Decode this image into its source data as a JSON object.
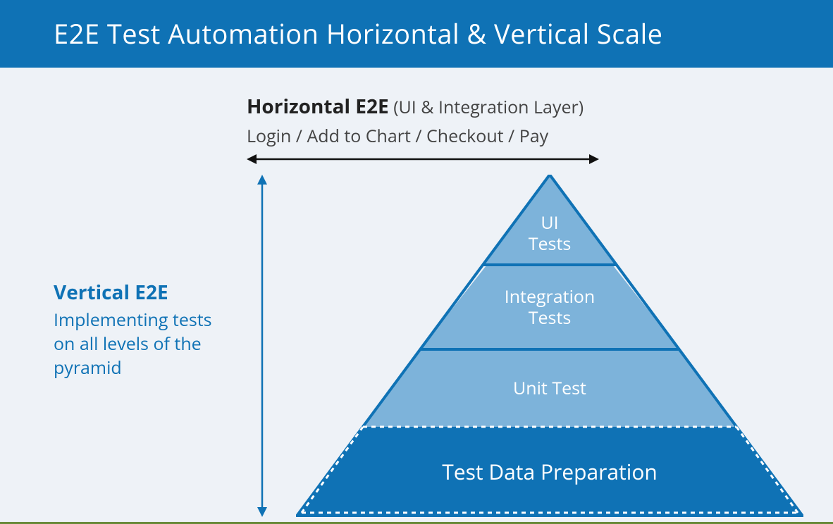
{
  "header": {
    "title": "E2E Test Automation Horizontal & Vertical Scale"
  },
  "horizontal": {
    "title": "Horizontal E2E",
    "subtitle": "(UI & Integration Layer)",
    "examples": "Login / Add to Chart / Checkout / Pay"
  },
  "vertical": {
    "title": "Vertical E2E",
    "description": "Implementing tests on all levels of the pyramid"
  },
  "pyramid": {
    "layers": [
      {
        "name": "ui-tests",
        "label": "UI\nTests"
      },
      {
        "name": "integration",
        "label": "Integration\nTests"
      },
      {
        "name": "unit",
        "label": "Unit Test"
      },
      {
        "name": "test-data-prep",
        "label": "Test Data Preparation"
      }
    ]
  },
  "colors": {
    "brand_blue": "#0f72b5",
    "layer_light": "#7db3da",
    "bg": "#eef2f7",
    "footer": "#6a8a3a"
  }
}
